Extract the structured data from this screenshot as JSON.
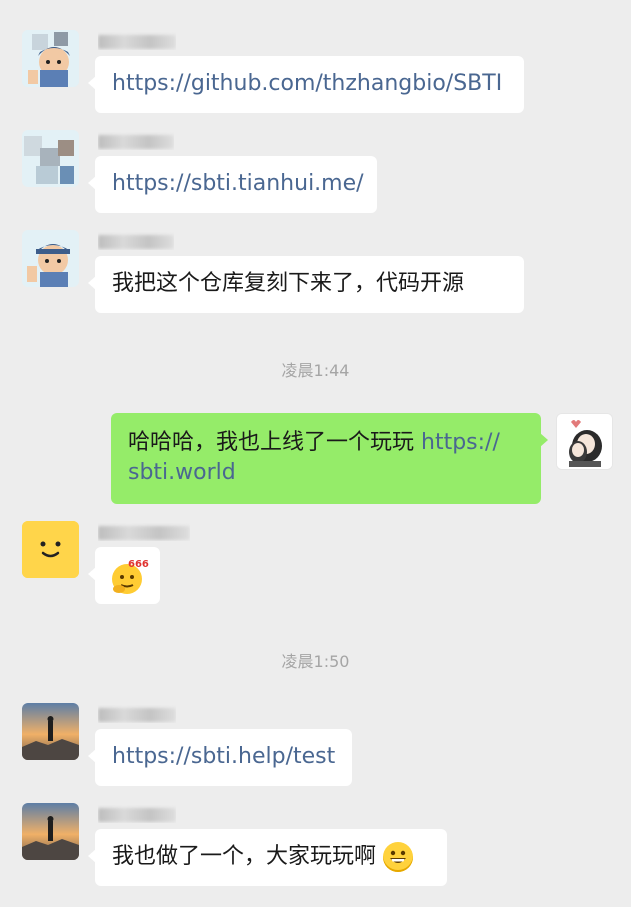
{
  "messages": [
    {
      "sender_visible": "",
      "text": "https://github.com/thzhangbio/SBTI"
    },
    {
      "sender_visible": "",
      "text": "https://sbti.tianhui.me/"
    },
    {
      "sender_visible": "",
      "text": "我把这个仓库复刻下来了，代码开源"
    },
    {
      "self": true,
      "text_plain": "哈哈哈，我也上线了一个玩玩 ",
      "link_part1": "https://",
      "link_part2": "sbti.world"
    },
    {
      "sender_visible": "",
      "sticker": "666 emoji"
    },
    {
      "sender_visible": "",
      "text": "https://sbti.help/test"
    },
    {
      "sender_visible": "",
      "text": "我也做了一个，大家玩玩啊"
    }
  ],
  "timestamps": [
    "凌晨1:44",
    "凌晨1:50"
  ],
  "sticker_label": "666",
  "colors": {
    "background": "#ededed",
    "bubble_incoming": "#ffffff",
    "bubble_outgoing": "#95ec69",
    "link": "#4a6791",
    "timestamp": "#a5a5a5"
  },
  "icons": {
    "avatar_1": "cartoon-boy-avatar-icon",
    "avatar_self": "couple-sketch-avatar-icon",
    "avatar_smile": "yellow-smile-avatar-icon",
    "avatar_sunset": "sunset-silhouette-avatar-icon",
    "grin_emoji": "grinning-face-emoji-icon",
    "sticker": "thinking-666-emoji-icon"
  }
}
